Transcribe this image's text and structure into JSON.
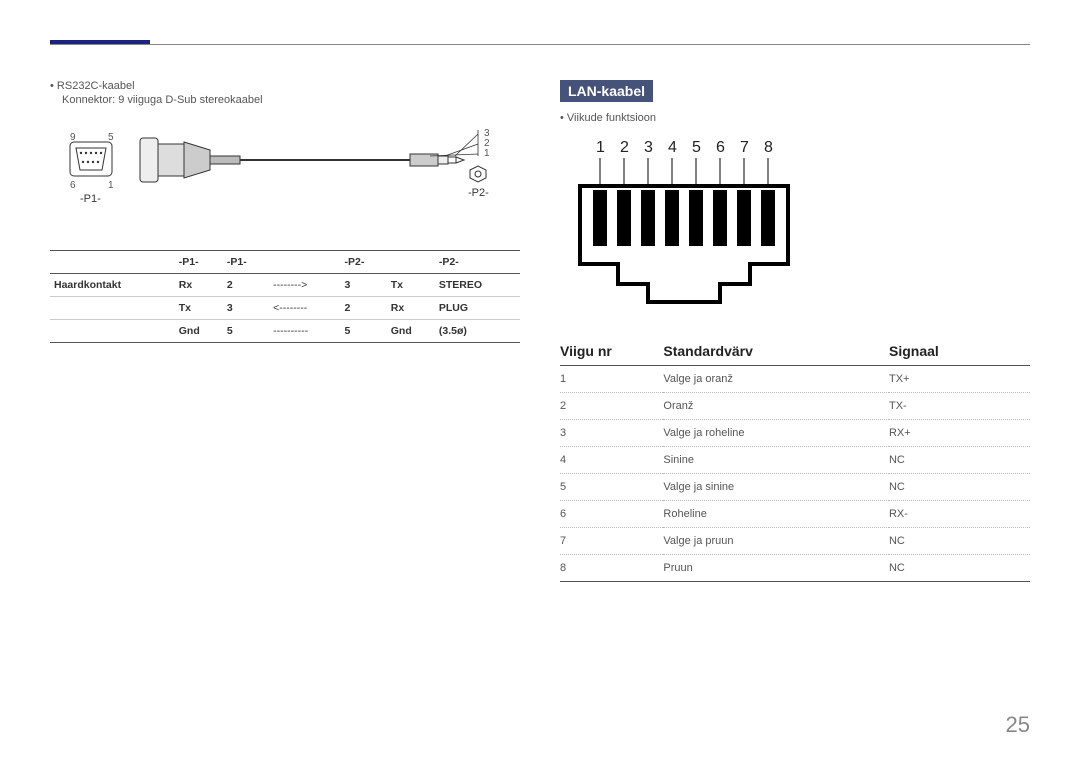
{
  "page_number": "25",
  "left": {
    "bullet1": "RS232C-kaabel",
    "sub1": "Konnektor: 9 viiguga D-Sub stereokaabel",
    "diag": {
      "dsub_tl": "9",
      "dsub_tr": "5",
      "dsub_bl": "6",
      "dsub_br": "1",
      "p1": "-P1-",
      "p2": "-P2-",
      "jack3": "3",
      "jack2": "2",
      "jack1": "1"
    },
    "table": {
      "head": {
        "c1": "-P1-",
        "c2": "-P1-",
        "c3": "",
        "c4": "-P2-",
        "c5": "",
        "c6": "-P2-"
      },
      "rows": [
        {
          "c0": "Haardkontakt",
          "c1": "Rx",
          "c2": "2",
          "c3": "-------->",
          "c4": "3",
          "c5": "Tx",
          "c6": "STEREO"
        },
        {
          "c0": "",
          "c1": "Tx",
          "c2": "3",
          "c3": "<--------",
          "c4": "2",
          "c5": "Rx",
          "c6": "PLUG"
        },
        {
          "c0": "",
          "c1": "Gnd",
          "c2": "5",
          "c3": "----------",
          "c4": "5",
          "c5": "Gnd",
          "c6": "(3.5ø)"
        }
      ]
    }
  },
  "right": {
    "heading": "LAN-kaabel",
    "bullet1": "Viikude funktsioon",
    "rj45_numbers": [
      "1",
      "2",
      "3",
      "4",
      "5",
      "6",
      "7",
      "8"
    ],
    "table_head": {
      "c1": "Viigu nr",
      "c2": "Standardvärv",
      "c3": "Signaal"
    },
    "rows": [
      {
        "n": "1",
        "color": "Valge ja oranž",
        "sig": "TX+"
      },
      {
        "n": "2",
        "color": "Oranž",
        "sig": "TX-"
      },
      {
        "n": "3",
        "color": "Valge ja roheline",
        "sig": "RX+"
      },
      {
        "n": "4",
        "color": "Sinine",
        "sig": "NC"
      },
      {
        "n": "5",
        "color": "Valge ja sinine",
        "sig": "NC"
      },
      {
        "n": "6",
        "color": "Roheline",
        "sig": "RX-"
      },
      {
        "n": "7",
        "color": "Valge ja pruun",
        "sig": "NC"
      },
      {
        "n": "8",
        "color": "Pruun",
        "sig": "NC"
      }
    ]
  }
}
